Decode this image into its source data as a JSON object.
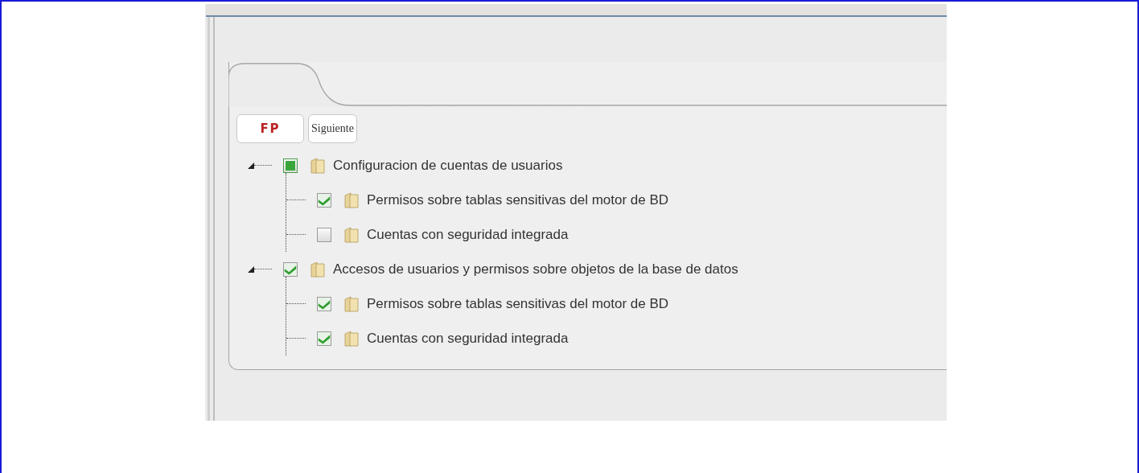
{
  "buttons": [
    {
      "label": "FP",
      "kind": "logo"
    },
    {
      "label": "Siguiente",
      "kind": "plain"
    }
  ],
  "tree": [
    {
      "label": "Configuracion de cuentas de usuarios",
      "checked": false,
      "partial": true,
      "children": [
        {
          "label": "Permisos sobre tablas sensitivas del motor de BD",
          "checked": true
        },
        {
          "label": "Cuentas con seguridad integrada",
          "checked": false
        }
      ]
    },
    {
      "label": "Accesos de usuarios y permisos sobre objetos de la base de datos",
      "checked": true,
      "children": [
        {
          "label": "Permisos sobre tablas sensitivas del motor de BD",
          "checked": true
        },
        {
          "label": "Cuentas con seguridad integrada",
          "checked": true
        }
      ]
    }
  ]
}
